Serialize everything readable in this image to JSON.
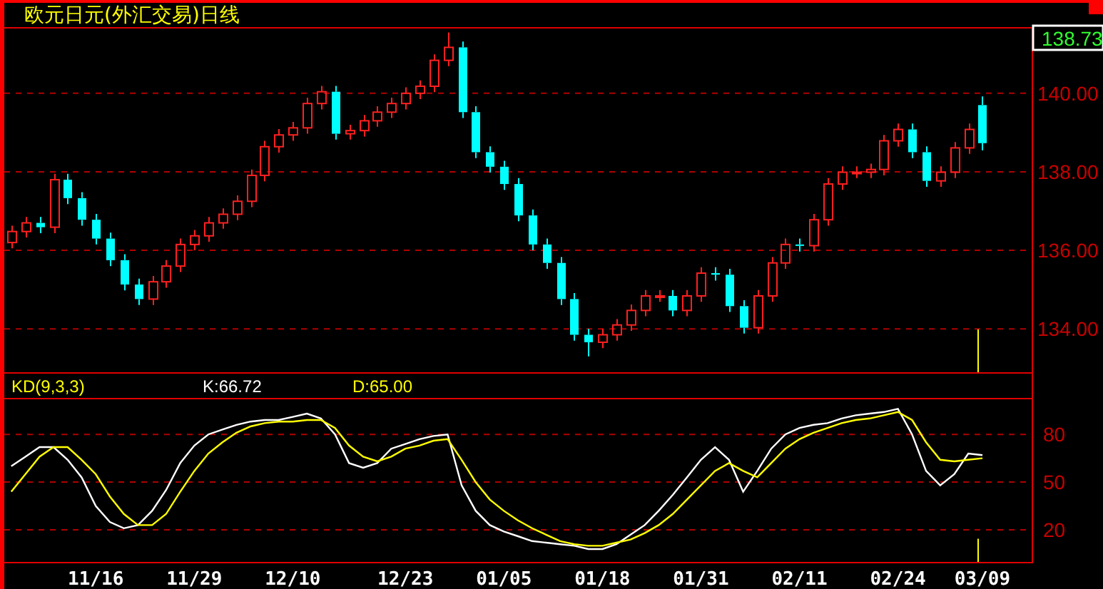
{
  "title": "欧元日元(外汇交易)日线",
  "price_panel": {
    "current_price": "138.73",
    "chart_data": {
      "type": "candlestick",
      "grid": true,
      "ylim": [
        132.86,
        141.65
      ],
      "yticks": [
        {
          "value": 134,
          "label": "134.00"
        },
        {
          "value": 136,
          "label": "136.00"
        },
        {
          "value": 138,
          "label": "138.00"
        },
        {
          "value": 140,
          "label": "140.00"
        }
      ],
      "categories": [
        null,
        null,
        null,
        null,
        null,
        null,
        null,
        null,
        null,
        null,
        null,
        null,
        null,
        null,
        null,
        null,
        null,
        null,
        null,
        null,
        null,
        null,
        null,
        null,
        null,
        null,
        null,
        null,
        null,
        null,
        null,
        null,
        null,
        null,
        null,
        null,
        null,
        null,
        null,
        null,
        null,
        null,
        null,
        null,
        null,
        null,
        null,
        null,
        null,
        null,
        null,
        null,
        null,
        null,
        null,
        null,
        null,
        null,
        null,
        null,
        null,
        null,
        null,
        null,
        null,
        null,
        null,
        null,
        null,
        null,
        null,
        null,
        null
      ],
      "ohlc": [
        [
          136.2,
          136.63,
          136.05,
          136.48
        ],
        [
          136.48,
          136.85,
          136.33,
          136.7
        ],
        [
          136.7,
          136.85,
          136.44,
          136.59
        ],
        [
          136.59,
          137.95,
          136.44,
          137.8
        ],
        [
          137.8,
          137.95,
          137.18,
          137.33
        ],
        [
          137.33,
          137.48,
          136.63,
          136.78
        ],
        [
          136.78,
          136.93,
          136.15,
          136.3
        ],
        [
          136.3,
          136.45,
          135.6,
          135.75
        ],
        [
          135.75,
          135.9,
          134.98,
          135.13
        ],
        [
          135.13,
          135.28,
          134.61,
          134.76
        ],
        [
          134.76,
          135.35,
          134.61,
          135.2
        ],
        [
          135.2,
          135.75,
          135.05,
          135.6
        ],
        [
          135.6,
          136.3,
          135.45,
          136.15
        ],
        [
          136.15,
          136.52,
          136.0,
          136.37
        ],
        [
          136.37,
          136.85,
          136.22,
          136.7
        ],
        [
          136.7,
          137.07,
          136.55,
          136.92
        ],
        [
          136.92,
          137.4,
          136.77,
          137.25
        ],
        [
          137.25,
          138.06,
          137.1,
          137.91
        ],
        [
          137.91,
          138.79,
          137.76,
          138.64
        ],
        [
          138.64,
          139.09,
          138.49,
          138.94
        ],
        [
          138.94,
          139.27,
          138.79,
          139.12
        ],
        [
          139.12,
          139.89,
          138.97,
          139.74
        ],
        [
          139.74,
          140.19,
          139.59,
          140.04
        ],
        [
          140.04,
          140.19,
          138.82,
          138.97
        ],
        [
          138.97,
          139.2,
          138.82,
          139.05
        ],
        [
          139.05,
          139.45,
          138.9,
          139.3
        ],
        [
          139.3,
          139.67,
          139.15,
          139.52
        ],
        [
          139.52,
          139.89,
          139.37,
          139.74
        ],
        [
          139.74,
          140.15,
          139.59,
          140.0
        ],
        [
          140.0,
          140.33,
          139.85,
          140.18
        ],
        [
          140.18,
          140.99,
          140.03,
          140.84
        ],
        [
          140.84,
          141.55,
          140.69,
          141.17
        ],
        [
          141.17,
          141.32,
          139.37,
          139.52
        ],
        [
          139.52,
          139.67,
          138.35,
          138.5
        ],
        [
          138.5,
          138.65,
          137.98,
          138.13
        ],
        [
          138.13,
          138.28,
          137.54,
          137.69
        ],
        [
          137.69,
          137.84,
          136.74,
          136.89
        ],
        [
          136.89,
          137.04,
          136.0,
          136.15
        ],
        [
          136.15,
          136.3,
          135.53,
          135.68
        ],
        [
          135.68,
          135.83,
          134.61,
          134.76
        ],
        [
          134.76,
          134.91,
          133.7,
          133.85
        ],
        [
          133.85,
          134.0,
          133.3,
          133.66
        ],
        [
          133.66,
          134.0,
          133.51,
          133.85
        ],
        [
          133.85,
          134.25,
          133.7,
          134.1
        ],
        [
          134.1,
          134.62,
          133.95,
          134.47
        ],
        [
          134.47,
          134.99,
          134.32,
          134.84
        ],
        [
          134.84,
          134.99,
          134.69,
          134.84
        ],
        [
          134.84,
          134.99,
          134.32,
          134.47
        ],
        [
          134.47,
          134.99,
          134.32,
          134.84
        ],
        [
          134.84,
          135.57,
          134.69,
          135.42
        ],
        [
          135.42,
          135.57,
          135.23,
          135.38
        ],
        [
          135.38,
          135.53,
          134.43,
          134.58
        ],
        [
          134.58,
          134.73,
          133.88,
          134.03
        ],
        [
          134.03,
          134.99,
          133.88,
          134.84
        ],
        [
          134.84,
          135.83,
          134.69,
          135.68
        ],
        [
          135.68,
          136.3,
          135.53,
          136.15
        ],
        [
          136.15,
          136.3,
          135.97,
          136.12
        ],
        [
          136.12,
          136.93,
          135.97,
          136.78
        ],
        [
          136.78,
          137.84,
          136.63,
          137.69
        ],
        [
          137.69,
          138.14,
          137.54,
          137.99
        ],
        [
          137.99,
          138.14,
          137.84,
          137.99
        ],
        [
          137.99,
          138.21,
          137.84,
          138.06
        ],
        [
          138.06,
          138.94,
          137.91,
          138.79
        ],
        [
          138.79,
          139.23,
          138.64,
          139.08
        ],
        [
          139.08,
          139.23,
          138.35,
          138.5
        ],
        [
          138.5,
          138.65,
          137.62,
          137.77
        ],
        [
          137.77,
          138.14,
          137.62,
          137.99
        ],
        [
          137.99,
          138.76,
          137.84,
          138.61
        ],
        [
          138.61,
          139.23,
          138.46,
          139.08
        ],
        [
          139.7,
          139.92,
          138.55,
          138.73
        ],
        null,
        null,
        null
      ]
    }
  },
  "indicator_panel": {
    "label": "KD(9,3,3)",
    "readings": [
      {
        "text": "K:66.72",
        "color": "#ffffff"
      },
      {
        "text": "D:65.00",
        "color": "#ffff00"
      }
    ],
    "chart_data": {
      "type": "line",
      "grid": true,
      "ylim": [
        -1,
        102
      ],
      "yticks": [
        20,
        50,
        80
      ],
      "categories": [
        null,
        null,
        null,
        null,
        null,
        null,
        "11/16",
        null,
        null,
        null,
        null,
        null,
        null,
        "11/29",
        null,
        null,
        null,
        null,
        null,
        null,
        "12/10",
        null,
        null,
        null,
        null,
        null,
        null,
        null,
        "12/23",
        null,
        null,
        null,
        null,
        null,
        null,
        "01/05",
        null,
        null,
        null,
        null,
        null,
        null,
        "01/18",
        null,
        null,
        null,
        null,
        null,
        null,
        "01/31",
        null,
        null,
        null,
        null,
        null,
        null,
        "02/11",
        null,
        null,
        null,
        null,
        null,
        null,
        "02/24",
        null,
        null,
        null,
        null,
        null,
        "03/09",
        null,
        null,
        null
      ],
      "series": [
        {
          "color": "#ffffff",
          "values": [
            60,
            66,
            72,
            72,
            64,
            53,
            35,
            25,
            21,
            23,
            32,
            45,
            62,
            73,
            80,
            83,
            86,
            88,
            89,
            89,
            91,
            93,
            90,
            80,
            62,
            59,
            62,
            71,
            74,
            77,
            79,
            80,
            48,
            32,
            23,
            19,
            16,
            13,
            12,
            11,
            10,
            8,
            8,
            11,
            17,
            23,
            32,
            42,
            53,
            64,
            72,
            64,
            44,
            57,
            71,
            80,
            84,
            86,
            87,
            90,
            92,
            93,
            94,
            96,
            80,
            57,
            48,
            55,
            68,
            67,
            null,
            null,
            null
          ]
        },
        {
          "color": "#ffff00",
          "values": [
            44,
            55,
            66,
            72,
            72,
            64,
            55,
            41,
            30,
            23,
            23,
            30,
            44,
            57,
            68,
            75,
            81,
            85,
            87,
            88,
            88,
            89,
            89,
            84,
            73,
            66,
            63,
            66,
            71,
            73,
            76,
            77,
            64,
            50,
            39,
            32,
            26,
            21,
            17,
            13,
            11,
            10,
            10,
            12,
            14,
            18,
            23,
            30,
            39,
            48,
            57,
            62,
            57,
            53,
            62,
            71,
            77,
            81,
            84,
            87,
            89,
            90,
            92,
            94,
            89,
            75,
            64,
            63,
            64,
            65,
            null,
            null,
            null
          ]
        }
      ]
    }
  }
}
